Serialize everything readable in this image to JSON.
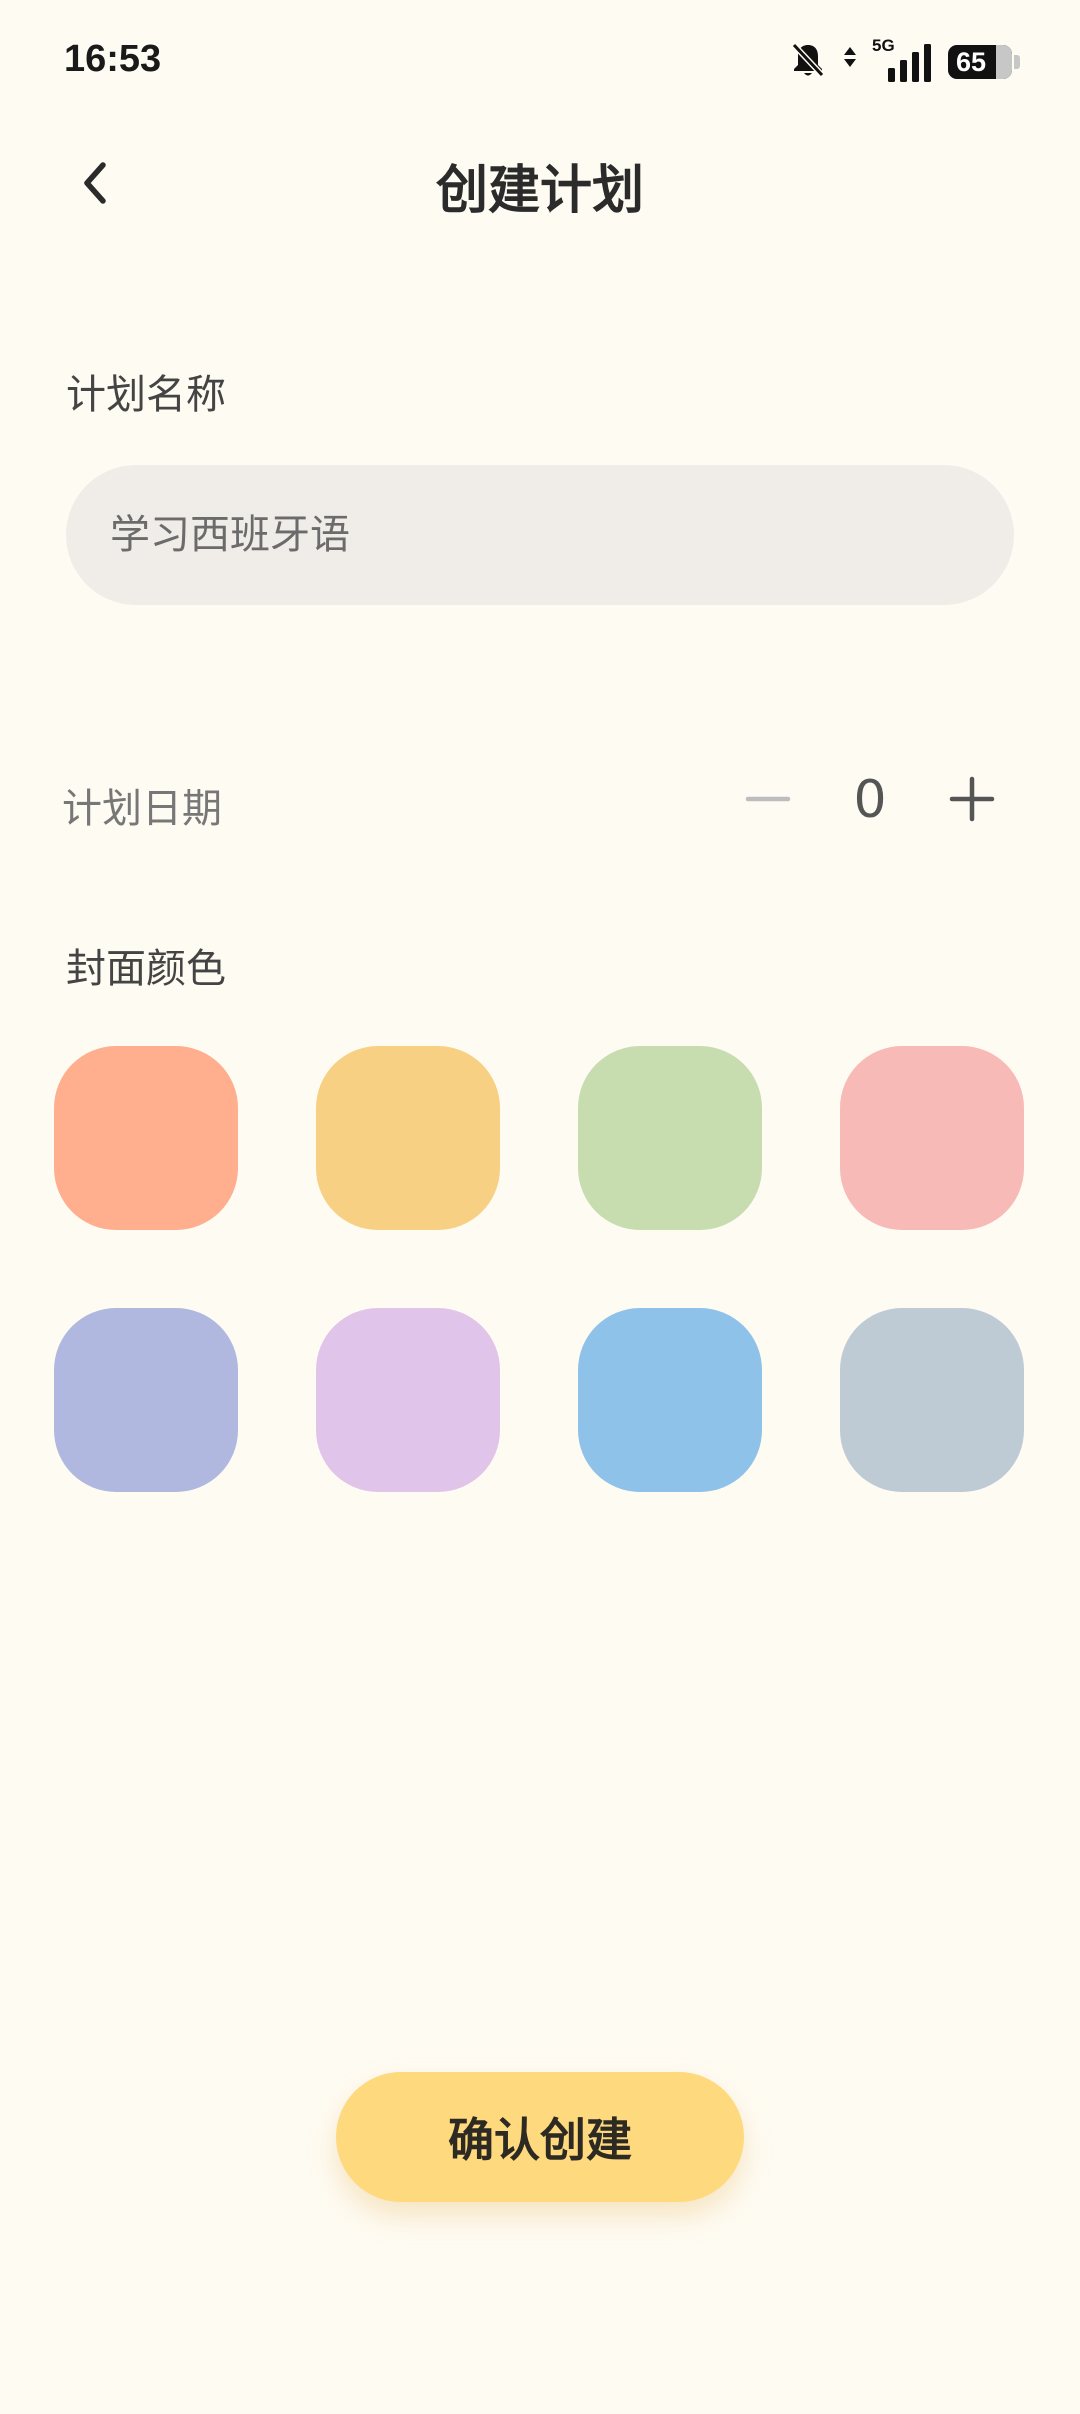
{
  "status_bar": {
    "time": "16:53",
    "network": "5G",
    "battery": "65",
    "icons": [
      "bell-muted-icon",
      "data-arrows-icon",
      "signal-icon",
      "battery-icon"
    ]
  },
  "header": {
    "title": "创建计划",
    "back_icon": "chevron-left-icon"
  },
  "plan_name": {
    "label": "计划名称",
    "value": "",
    "placeholder": "学习西班牙语"
  },
  "plan_date": {
    "label": "计划日期",
    "value": "0",
    "decrement_icon": "minus-icon",
    "increment_icon": "plus-icon"
  },
  "cover_color": {
    "label": "封面颜色",
    "colors": [
      "#FFAE8E",
      "#F8D083",
      "#C7DDB0",
      "#F7BAB6",
      "#B0B8E0",
      "#E1C4EA",
      "#8EC2E9",
      "#BECAD4"
    ]
  },
  "confirm": {
    "label": "确认创建"
  },
  "theme": {
    "background": "#FEFBF2",
    "accent": "#FFD97E",
    "input_background": "#F0ECE8"
  }
}
